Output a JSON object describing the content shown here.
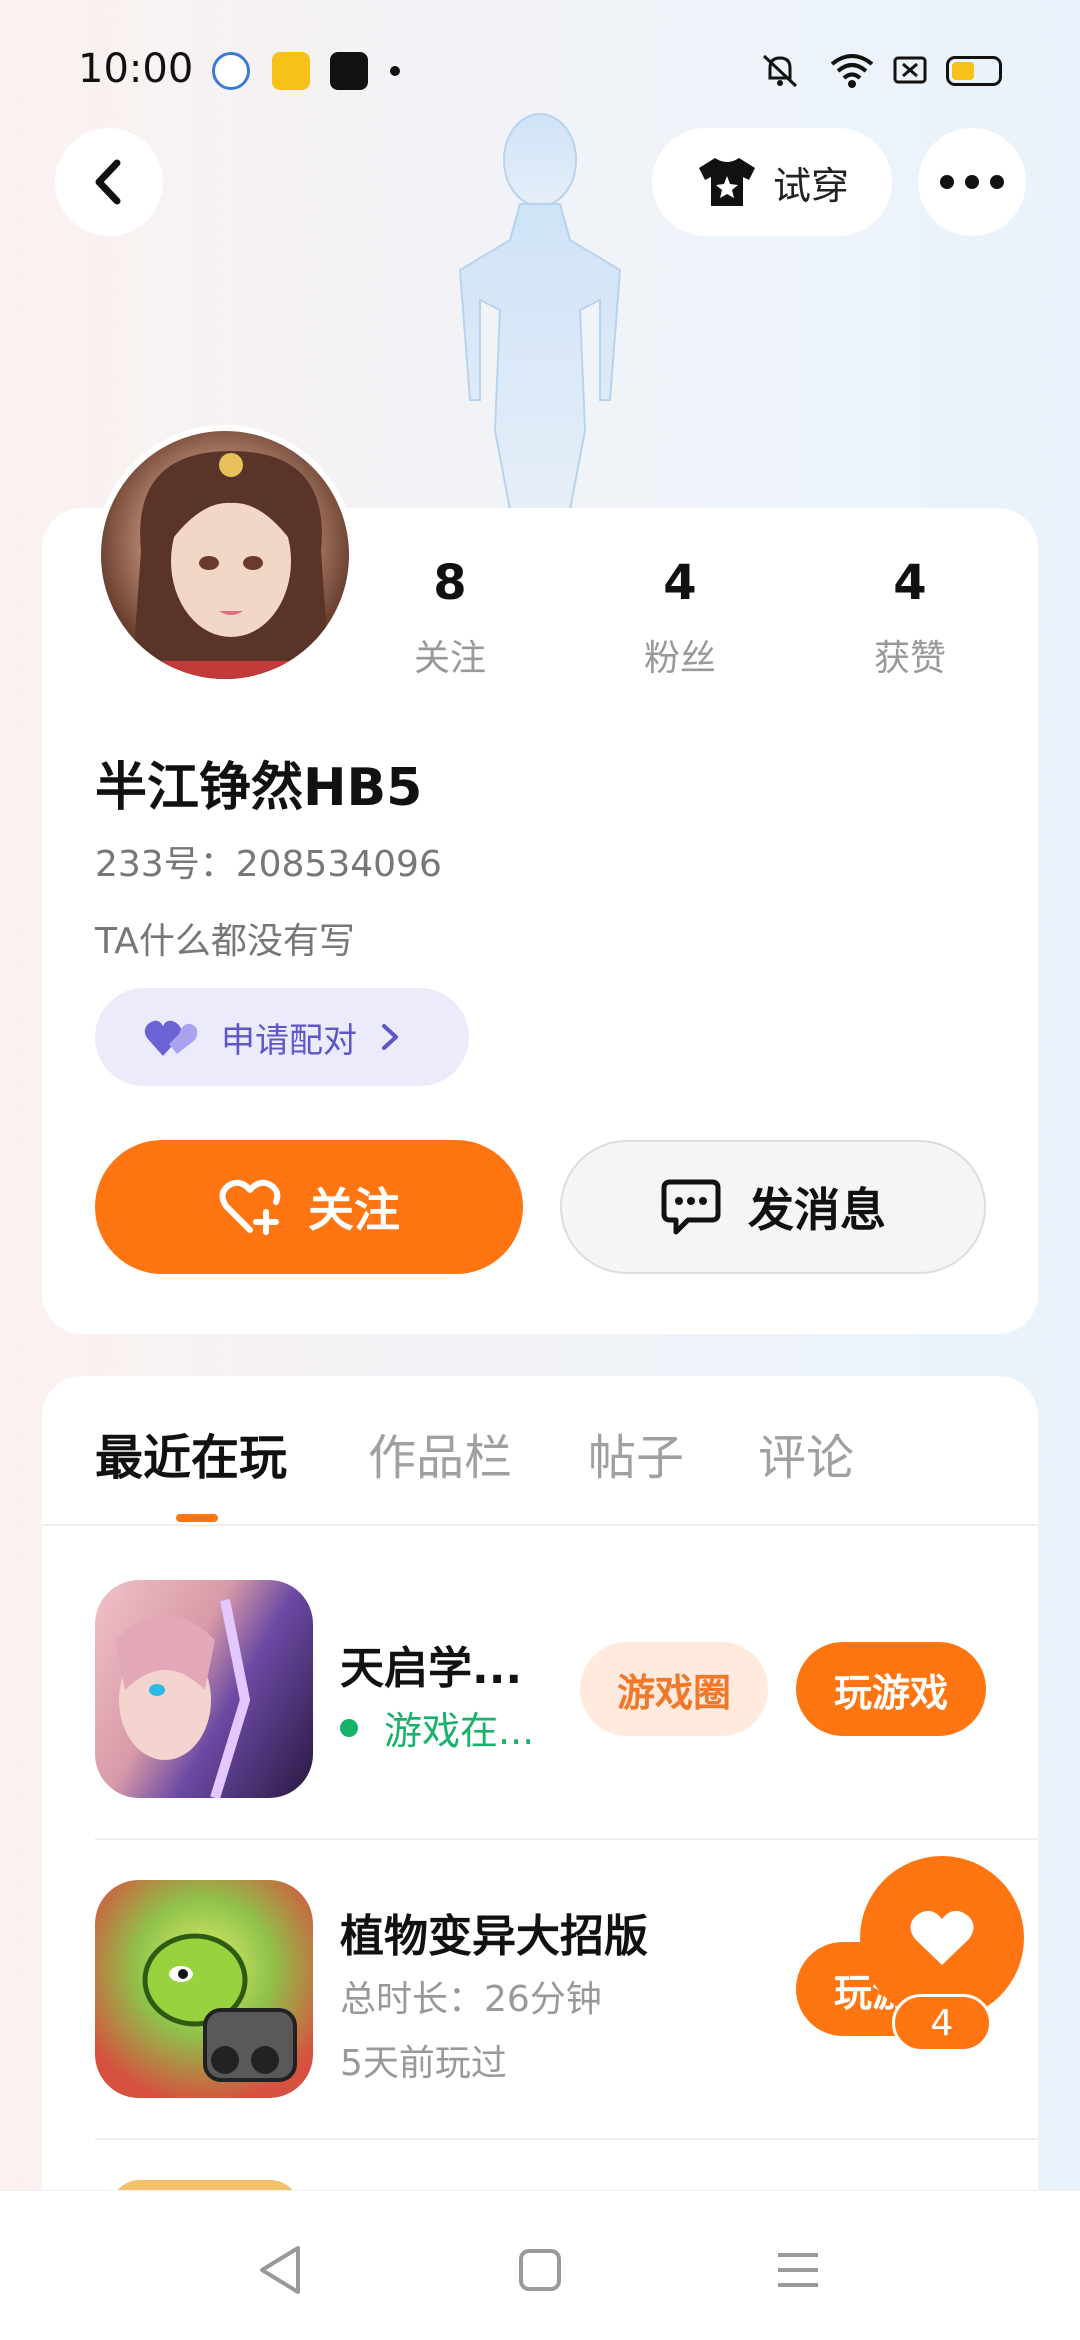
{
  "status_bar": {
    "time": "10:00"
  },
  "header": {
    "try_on_label": "试穿"
  },
  "profile": {
    "stats": [
      {
        "value": "8",
        "label": "关注"
      },
      {
        "value": "4",
        "label": "粉丝"
      },
      {
        "value": "4",
        "label": "获赞"
      }
    ],
    "username": "半江铮然HB5",
    "user_id": "233号：208534096",
    "bio": "TA什么都没有写",
    "pair_label": "申请配对",
    "follow_label": "关注",
    "message_label": "发消息"
  },
  "tabs": [
    {
      "label": "最近在玩",
      "active": true
    },
    {
      "label": "作品栏",
      "active": false
    },
    {
      "label": "帖子",
      "active": false
    },
    {
      "label": "评论",
      "active": false
    }
  ],
  "games": [
    {
      "title": "天启学...",
      "status": "游戏在...",
      "circle_label": "游戏圈",
      "play_label": "玩游戏"
    },
    {
      "title": "植物变异大招版",
      "duration": "总时长：26分钟",
      "last_played": "5天前玩过",
      "play_label": "玩游戏"
    }
  ],
  "floating_like": {
    "count": "4"
  },
  "colors": {
    "accent": "#ff7512",
    "pair": "#5e57c9",
    "online": "#18b26b"
  }
}
